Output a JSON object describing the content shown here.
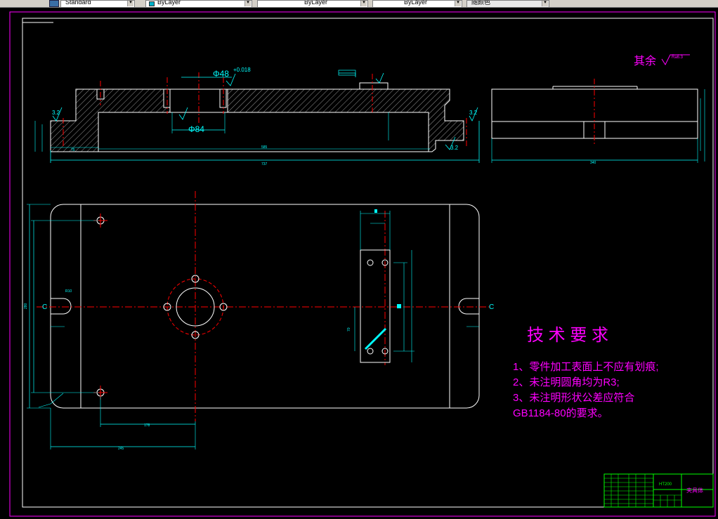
{
  "toolbar": {
    "text_style": "Standard",
    "color_control": "ByLayer",
    "linetype_control": "ByLayer",
    "lineweight_control": "ByLayer",
    "plot_style": "随颜色"
  },
  "drawing": {
    "surface_finish": "其余",
    "surface_finish_value": "Ra6.3",
    "dim_phi48": "Φ48",
    "dim_tol": "+0.018",
    "dim_phi84": "Φ84",
    "dim_32a": "3.2",
    "dim_32b": "3.2",
    "dim_32c": "3.2",
    "dim_total_len": "737",
    "dim_inner_len": "585",
    "dim_left": "75",
    "dim_side_width": "340",
    "dim_plan_height": "280",
    "dim_plan_left": "245",
    "dim_plan_mid": "178",
    "dim_slot": "70",
    "dim_r10": "R10",
    "dim_label_c": "C",
    "tech_title": "技 术 要 求",
    "tech_reqs": [
      "1、零件加工表面上不应有划痕;",
      "2、未注明圆角均为R3;",
      "3、未注明形状公差应符合",
      "GB1184-80的要求。"
    ],
    "title_block_material": "HT200",
    "title_block_name": "夹具体"
  },
  "colors": {
    "background": "#000000",
    "outline": "#ffffff",
    "dimension": "#00ffff",
    "centerline": "#ff0000",
    "annotation": "#ff00ff",
    "title_block": "#00ff00"
  }
}
